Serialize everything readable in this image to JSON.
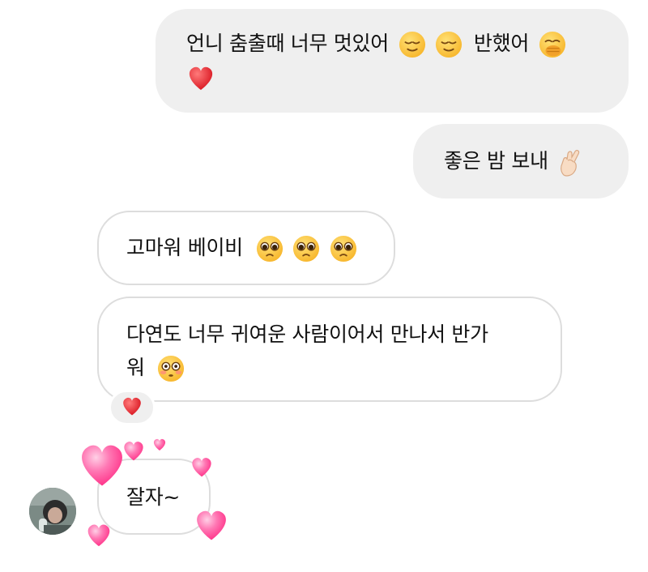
{
  "messages": [
    {
      "id": "msg1",
      "direction": "sent",
      "lines": [
        "언니 춤출때 너무 멋있어",
        "반했어"
      ],
      "emojis": [
        "relieved-face",
        "relieved-face",
        "face-with-hand-over-mouth",
        "red-heart"
      ]
    },
    {
      "id": "msg2",
      "direction": "sent",
      "text": "좋은 밤 보내",
      "emojis": [
        "hand-with-index-finger-and-thumb-crossed-light-skin-tone"
      ]
    },
    {
      "id": "msg3",
      "direction": "received",
      "text": "고마워 베이비",
      "emojis": [
        "pleading-face",
        "pleading-face",
        "pleading-face"
      ]
    },
    {
      "id": "msg4",
      "direction": "received",
      "lines": [
        "다연도 너무 귀여운 사람이어서 만나서 반가",
        "워"
      ],
      "emojis": [
        "flushed-face"
      ],
      "reaction": "red-heart"
    },
    {
      "id": "msg5",
      "direction": "received",
      "text": "잘자~",
      "effect": "floating-pink-hearts"
    }
  ],
  "colors": {
    "sent_bubble": "#efefef",
    "received_border": "#dddddd",
    "heart_pink": "#ff4f98",
    "heart_red": "#e0242f"
  }
}
